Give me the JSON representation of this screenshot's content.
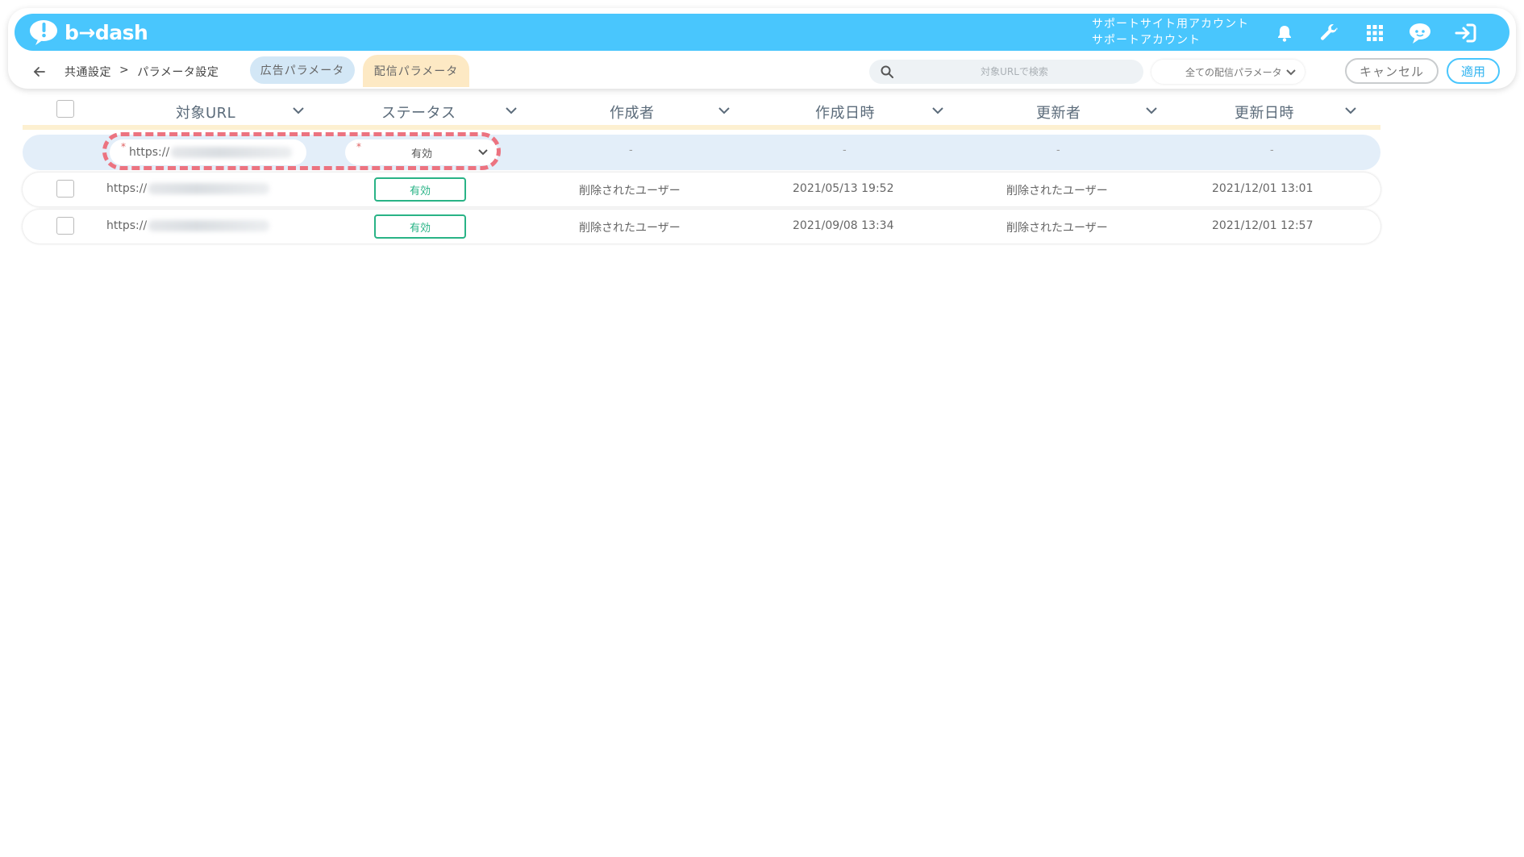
{
  "header": {
    "logo_text": "b→dash",
    "account_line1": "サポートサイト用アカウント",
    "account_line2": "サポートアカウント",
    "icons": [
      "bell-icon",
      "wrench-icon",
      "apps-grid-icon",
      "support-chat-icon",
      "logout-icon"
    ],
    "brand_color": "#49c6fd"
  },
  "subbar": {
    "breadcrumb": [
      "共通設定",
      ">",
      "パラメータ設定"
    ],
    "tabs": [
      {
        "label": "広告パラメータ",
        "active": false
      },
      {
        "label": "配信パラメータ",
        "active": true
      }
    ],
    "search_placeholder": "対象URLで検索",
    "filter_value": "全ての配信パラメータ",
    "cancel_label": "キャンセル",
    "apply_label": "適用"
  },
  "table": {
    "columns": [
      "対象URL",
      "ステータス",
      "作成者",
      "作成日時",
      "更新者",
      "更新日時"
    ],
    "new_row": {
      "url": "https://",
      "status": "有効",
      "creator": "-",
      "created_at": "-",
      "updater": "-",
      "updated_at": "-",
      "required_mark": "*"
    },
    "rows": [
      {
        "url": "https://",
        "status": "有効",
        "creator": "削除されたユーザー",
        "created_at": "2021/05/13 19:52",
        "updater": "削除されたユーザー",
        "updated_at": "2021/12/01 13:01"
      },
      {
        "url": "https://",
        "status": "有効",
        "creator": "削除されたユーザー",
        "created_at": "2021/09/08 13:34",
        "updater": "削除されたユーザー",
        "updated_at": "2021/12/01 12:57"
      }
    ],
    "status_color": "#29b386",
    "highlight_color": "#ec7380"
  }
}
